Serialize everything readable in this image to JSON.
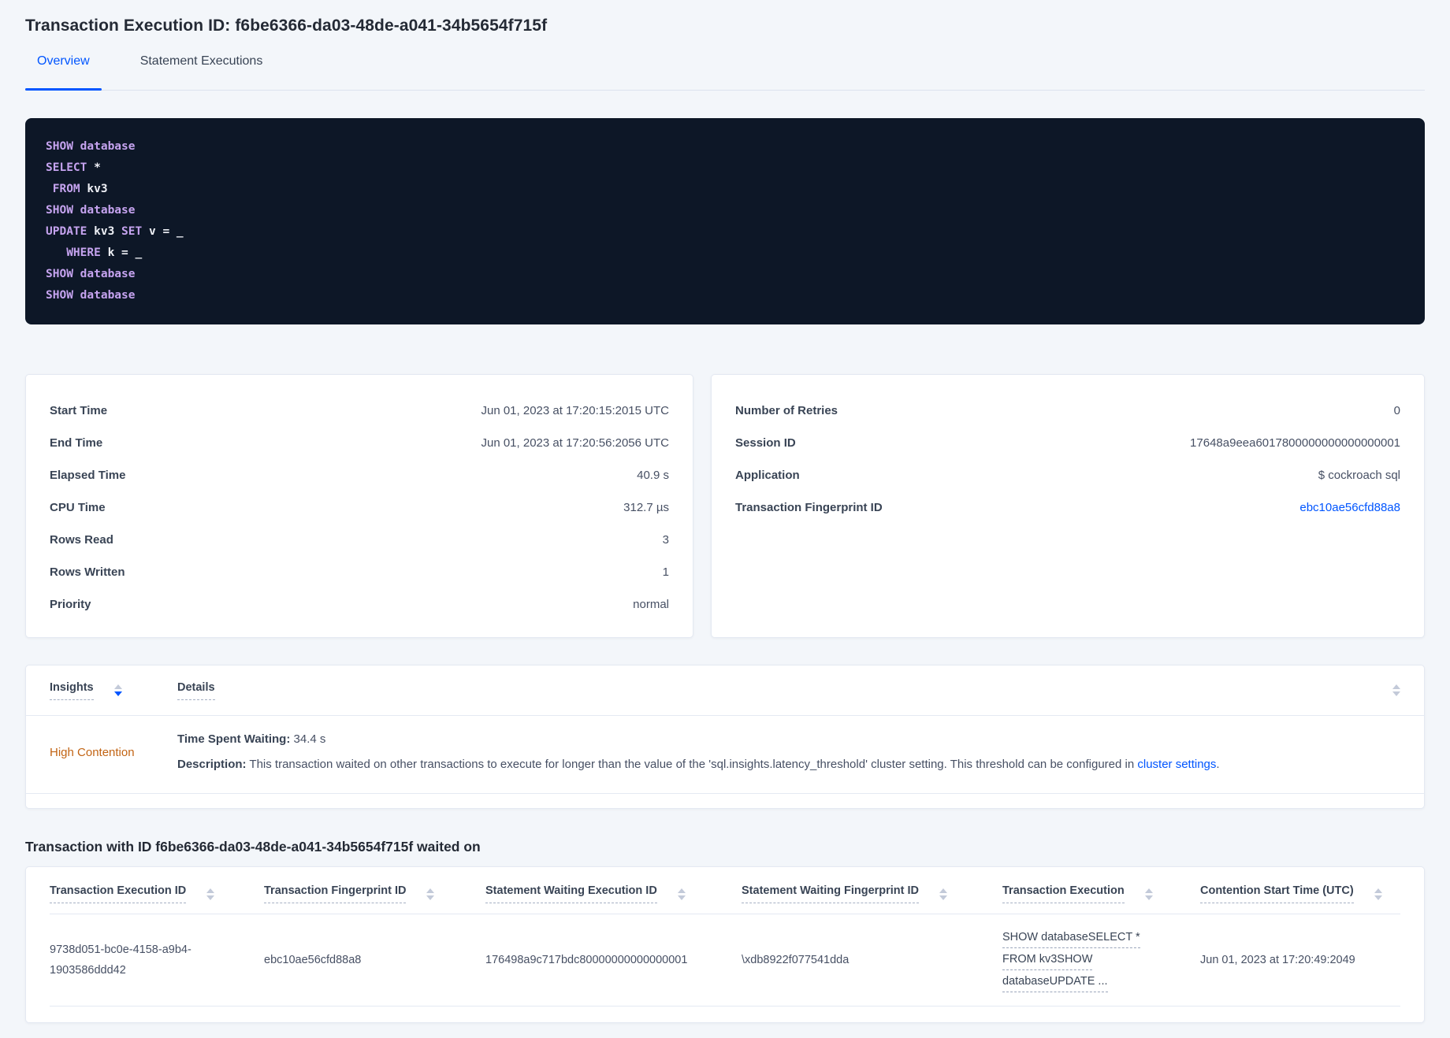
{
  "colors": {
    "accent_blue": "#0055ff",
    "insight_orange": "#c26414",
    "code_bg": "#0d1727",
    "code_keyword": "#c5a3ef",
    "code_plain": "#eef0f6"
  },
  "page": {
    "title": "Transaction Execution ID: f6be6366-da03-48de-a041-34b5654f715f"
  },
  "tabs": {
    "overview": "Overview",
    "statement_executions": "Statement Executions"
  },
  "sql": {
    "lines": [
      [
        {
          "c": "kw",
          "t": "SHOW"
        },
        {
          "c": "pl",
          "t": " "
        },
        {
          "c": "kw",
          "t": "database"
        }
      ],
      [
        {
          "c": "kw",
          "t": "SELECT"
        },
        {
          "c": "pl",
          "t": " *"
        }
      ],
      [
        {
          "c": "pl",
          "t": " "
        },
        {
          "c": "kw",
          "t": "FROM"
        },
        {
          "c": "pl",
          "t": " kv3"
        }
      ],
      [
        {
          "c": "kw",
          "t": "SHOW"
        },
        {
          "c": "pl",
          "t": " "
        },
        {
          "c": "kw",
          "t": "database"
        }
      ],
      [
        {
          "c": "kw",
          "t": "UPDATE"
        },
        {
          "c": "pl",
          "t": " kv3 "
        },
        {
          "c": "kw",
          "t": "SET"
        },
        {
          "c": "pl",
          "t": " v = _"
        }
      ],
      [
        {
          "c": "pl",
          "t": "   "
        },
        {
          "c": "kw",
          "t": "WHERE"
        },
        {
          "c": "pl",
          "t": " k = _"
        }
      ],
      [
        {
          "c": "kw",
          "t": "SHOW"
        },
        {
          "c": "pl",
          "t": " "
        },
        {
          "c": "kw",
          "t": "database"
        }
      ],
      [
        {
          "c": "kw",
          "t": "SHOW"
        },
        {
          "c": "pl",
          "t": " "
        },
        {
          "c": "kw",
          "t": "database"
        }
      ]
    ]
  },
  "summary_left": {
    "rows": [
      {
        "label": "Start Time",
        "value": "Jun 01, 2023 at 17:20:15:2015 UTC"
      },
      {
        "label": "End Time",
        "value": "Jun 01, 2023 at 17:20:56:2056 UTC"
      },
      {
        "label": "Elapsed Time",
        "value": "40.9 s"
      },
      {
        "label": "CPU Time",
        "value": "312.7 µs"
      },
      {
        "label": "Rows Read",
        "value": "3"
      },
      {
        "label": "Rows Written",
        "value": "1"
      },
      {
        "label": "Priority",
        "value": "normal"
      }
    ]
  },
  "summary_right": {
    "rows": [
      {
        "label": "Number of Retries",
        "value": "0"
      },
      {
        "label": "Session ID",
        "value": "17648a9eea6017800000000000000001"
      },
      {
        "label": "Application",
        "value": "$ cockroach sql"
      },
      {
        "label": "Transaction Fingerprint ID",
        "value": "ebc10ae56cfd88a8"
      }
    ]
  },
  "insights": {
    "col_insights": "Insights",
    "col_details": "Details",
    "row": {
      "name": "High Contention",
      "waiting_label": "Time Spent Waiting:",
      "waiting_value": "34.4 s",
      "description_label": "Description:",
      "description_text": "This transaction waited on other transactions to execute for longer than the value of the 'sql.insights.latency_threshold' cluster setting. This threshold can be configured in ",
      "description_link": "cluster settings",
      "description_end": "."
    }
  },
  "waited": {
    "title": "Transaction with ID f6be6366-da03-48de-a041-34b5654f715f waited on",
    "columns": [
      "Transaction Execution ID",
      "Transaction Fingerprint ID",
      "Statement Waiting Execution ID",
      "Statement Waiting Fingerprint ID",
      "Transaction Execution",
      "Contention Start Time (UTC)"
    ],
    "row": {
      "transaction_execution_id": "9738d051-bc0e-4158-a9b4-1903586ddd42",
      "transaction_fingerprint_id": "ebc10ae56cfd88a8",
      "statement_waiting_execution_id": "176498a9c717bdc80000000000000001",
      "statement_waiting_fingerprint_id": "\\xdb8922f077541dda",
      "transaction_execution_lines": [
        "SHOW databaseSELECT *",
        "FROM kv3SHOW",
        "databaseUPDATE ..."
      ],
      "contention_start_time": "Jun 01, 2023 at 17:20:49:2049"
    }
  }
}
